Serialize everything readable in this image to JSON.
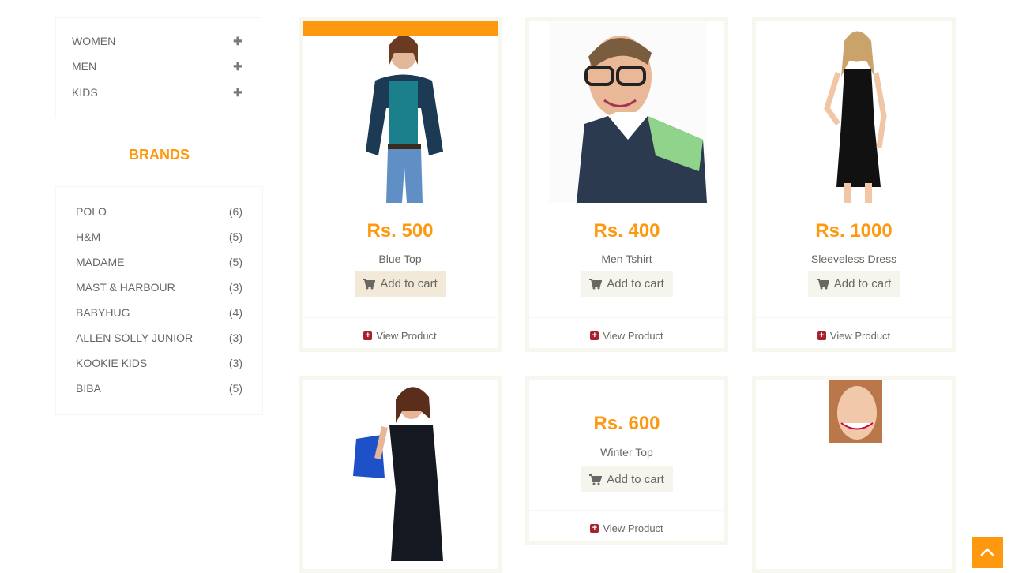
{
  "categories": [
    {
      "label": "WOMEN"
    },
    {
      "label": "MEN"
    },
    {
      "label": "KIDS"
    }
  ],
  "brands_title": "BRANDS",
  "brands": [
    {
      "name": "POLO",
      "count": "(6)"
    },
    {
      "name": "H&M",
      "count": "(5)"
    },
    {
      "name": "MADAME",
      "count": "(5)"
    },
    {
      "name": "MAST & HARBOUR",
      "count": "(3)"
    },
    {
      "name": "BABYHUG",
      "count": "(4)"
    },
    {
      "name": "ALLEN SOLLY JUNIOR",
      "count": "(3)"
    },
    {
      "name": "KOOKIE KIDS",
      "count": "(3)"
    },
    {
      "name": "BIBA",
      "count": "(5)"
    }
  ],
  "products": [
    {
      "price": "Rs. 500",
      "name": "Blue Top",
      "cart": "Add to cart",
      "view": "View Product"
    },
    {
      "price": "Rs. 400",
      "name": "Men Tshirt",
      "cart": "Add to cart",
      "view": "View Product"
    },
    {
      "price": "Rs. 1000",
      "name": "Sleeveless Dress",
      "cart": "Add to cart",
      "view": "View Product"
    },
    {
      "price": "Rs. 600",
      "name": "Winter Top",
      "cart": "Add to cart",
      "view": "View Product"
    }
  ],
  "colors": {
    "accent": "#FE980F",
    "text": "#696763",
    "button_bg": "#F5F5ED",
    "view_icon": "#a8222e"
  },
  "icons": {
    "expand": "plus-icon",
    "cart": "shopping-cart-icon",
    "view": "plus-square-icon",
    "scroll_up": "chevron-up-icon"
  }
}
